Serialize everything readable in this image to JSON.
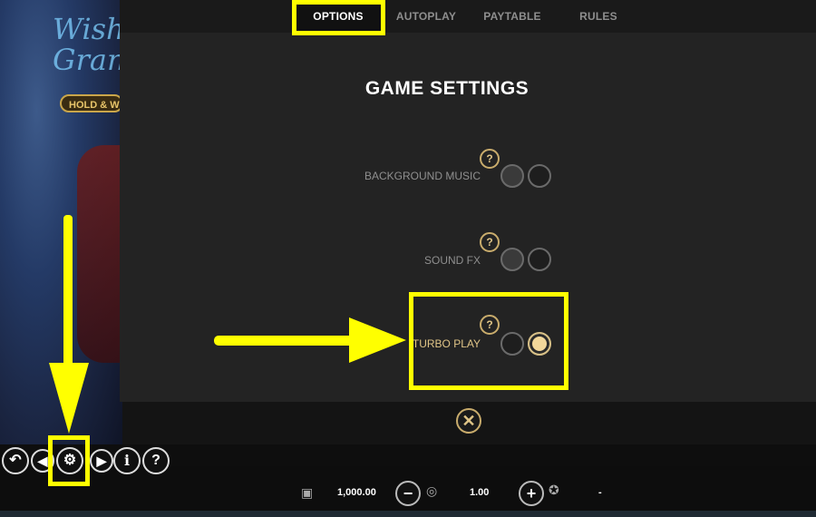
{
  "tabs": [
    {
      "label": "OPTIONS",
      "active": true
    },
    {
      "label": "AUTOPLAY",
      "active": false
    },
    {
      "label": "PAYTABLE",
      "active": false
    },
    {
      "label": "RULES",
      "active": false
    }
  ],
  "panel": {
    "title": "GAME SETTINGS",
    "settings": [
      {
        "label": "BACKGROUND MUSIC",
        "help": "?",
        "state": "off"
      },
      {
        "label": "SOUND FX",
        "help": "?",
        "state": "off"
      },
      {
        "label": "TURBO PLAY",
        "help": "?",
        "state": "on"
      }
    ],
    "close_label": "✕"
  },
  "game": {
    "logo_text": "Wish Grant",
    "badge_text": "HOLD & WIN"
  },
  "bottom": {
    "balance": "1,000.00",
    "bet": "1.00",
    "win": "-",
    "controls": {
      "back": "↶",
      "left": "◀",
      "settings": "⚙",
      "right": "▶",
      "info": "i",
      "help": "?",
      "minus": "−",
      "plus": "+"
    }
  },
  "colors": {
    "accent_gold": "#e0c587",
    "annotation_yellow": "#ffff00",
    "panel_bg": "#232323"
  }
}
